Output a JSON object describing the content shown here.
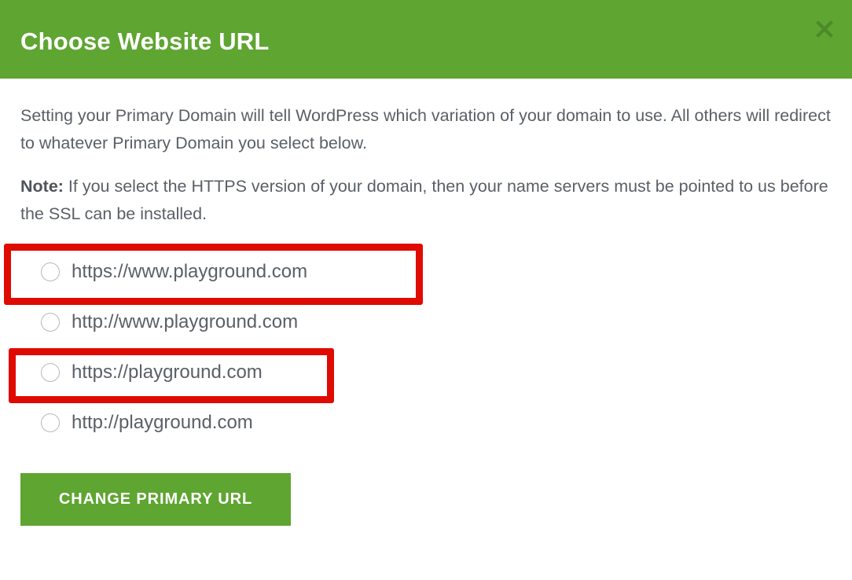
{
  "modal": {
    "title": "Choose Website URL",
    "close_icon": "close-icon",
    "header_color": "#5FA532",
    "body": {
      "intro": "Setting your Primary Domain will tell WordPress which variation of your domain to use. All others will redirect to whatever Primary Domain you select below.",
      "note_label": "Note:",
      "note_text": " If you select the HTTPS version of your domain, then your name servers must be pointed to us before the SSL can be installed."
    },
    "options": [
      {
        "label": "https://www.playground.com",
        "selected": false,
        "highlighted": true
      },
      {
        "label": "http://www.playground.com",
        "selected": false,
        "highlighted": false
      },
      {
        "label": "https://playground.com",
        "selected": false,
        "highlighted": true
      },
      {
        "label": "http://playground.com",
        "selected": false,
        "highlighted": false
      }
    ],
    "submit_label": "CHANGE PRIMARY URL",
    "annotation_color": "#E00B00",
    "text_color": "#5A6067"
  }
}
